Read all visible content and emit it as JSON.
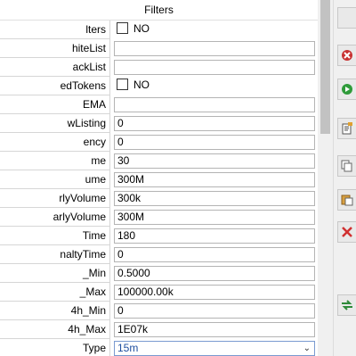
{
  "header": {
    "title": "Filters"
  },
  "rows": [
    {
      "name": "lters",
      "type": "check",
      "value": "NO"
    },
    {
      "name": "hiteList",
      "type": "text",
      "value": ""
    },
    {
      "name": "ackList",
      "type": "text",
      "value": ""
    },
    {
      "name": "edTokens",
      "type": "check",
      "value": "NO"
    },
    {
      "name": "EMA",
      "type": "text",
      "value": ""
    },
    {
      "name": "wListing",
      "type": "text",
      "value": "0"
    },
    {
      "name": "ency",
      "type": "text",
      "value": "0"
    },
    {
      "name": "me",
      "type": "text",
      "value": "30"
    },
    {
      "name": "ume",
      "type": "text",
      "value": "300M"
    },
    {
      "name": "rlyVolume",
      "type": "text",
      "value": "300k"
    },
    {
      "name": "arlyVolume",
      "type": "text",
      "value": "300M"
    },
    {
      "name": "Time",
      "type": "text",
      "value": "180"
    },
    {
      "name": "naltyTime",
      "type": "text",
      "value": "0"
    },
    {
      "name": "_Min",
      "type": "text",
      "value": "0.5000"
    },
    {
      "name": "_Max",
      "type": "text",
      "value": "100000.00k"
    },
    {
      "name": "4h_Min",
      "type": "text",
      "value": "0"
    },
    {
      "name": "4h_Max",
      "type": "text",
      "value": "1E07k"
    },
    {
      "name": "Type",
      "type": "select",
      "value": "15m"
    }
  ],
  "side_buttons": [
    {
      "icon": "blank-icon"
    },
    {
      "icon": "remove-red-icon"
    },
    {
      "icon": "play-green-icon"
    },
    {
      "icon": "edit-note-icon"
    },
    {
      "icon": "copy-icon"
    },
    {
      "icon": "paste-icon"
    },
    {
      "icon": "delete-x-icon"
    },
    {
      "icon": "swap-green-icon"
    }
  ]
}
